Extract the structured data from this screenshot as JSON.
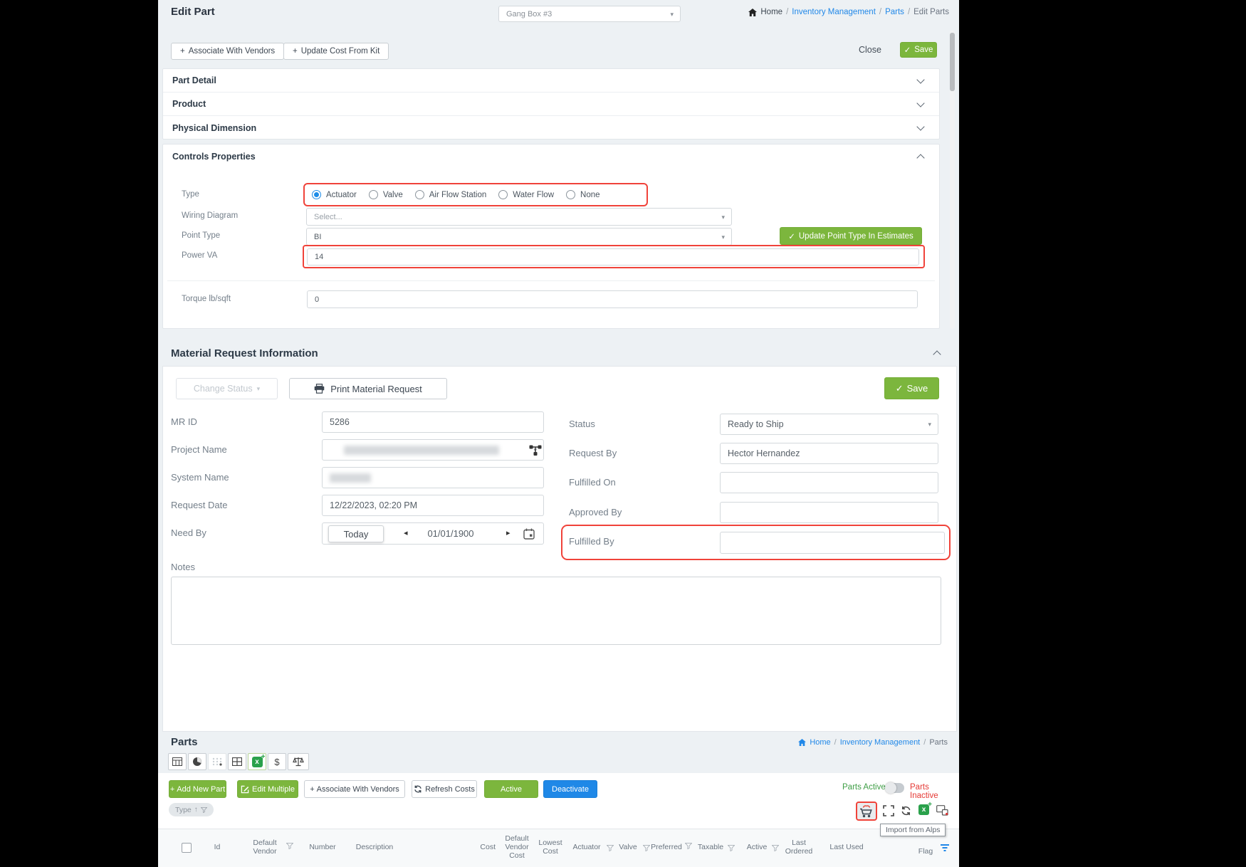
{
  "icons": {
    "plus": "+",
    "check": "✓",
    "caret_down": "▾",
    "caret_left": "◂",
    "caret_right": "▸",
    "sort_up": "↑",
    "dollar": "$",
    "slash": "/"
  },
  "edit_part": {
    "title": "Edit Part",
    "part_selector_value": "Gang Box #3",
    "breadcrumb": {
      "home": "Home",
      "inventory": "Inventory Management",
      "parts": "Parts",
      "current": "Edit Parts"
    },
    "associate_vendors_btn": "Associate With Vendors",
    "update_cost_btn": "Update Cost From Kit",
    "close_btn": "Close",
    "save_btn": "Save",
    "sections": {
      "part_detail": "Part Detail",
      "product": "Product",
      "physical_dimension": "Physical Dimension",
      "controls_properties": "Controls Properties"
    },
    "controls": {
      "type_label": "Type",
      "type_options": [
        "Actuator",
        "Valve",
        "Air Flow Station",
        "Water Flow",
        "None"
      ],
      "selected_type": "Actuator",
      "wiring_label": "Wiring Diagram",
      "wiring_placeholder": "Select...",
      "point_type_label": "Point Type",
      "point_type_value": "BI",
      "update_point_btn": "Update Point Type In Estimates",
      "power_va_label": "Power VA",
      "power_va_value": "14",
      "torque_label": "Torque lb/sqft",
      "torque_value": "0"
    }
  },
  "material_request": {
    "title": "Material Request Information",
    "change_status_btn": "Change Status",
    "print_btn": "Print Material Request",
    "save_btn": "Save",
    "mr_id_label": "MR ID",
    "mr_id_value": "5286",
    "project_name_label": "Project Name",
    "system_name_label": "System Name",
    "request_date_label": "Request Date",
    "request_date_value": "12/22/2023, 02:20 PM",
    "need_by_label": "Need By",
    "today_btn": "Today",
    "need_by_date": "01/01/1900",
    "status_label": "Status",
    "status_value": "Ready to Ship",
    "request_by_label": "Request By",
    "request_by_value": "Hector Hernandez",
    "fulfilled_on_label": "Fulfilled On",
    "approved_by_label": "Approved By",
    "fulfilled_by_label": "Fulfilled By",
    "notes_label": "Notes"
  },
  "parts_grid": {
    "title": "Parts",
    "breadcrumb": {
      "home": "Home",
      "inventory": "Inventory Management",
      "current": "Parts"
    },
    "add_new_btn": "Add New Part",
    "edit_multiple_btn": "Edit Multiple",
    "associate_vendors_btn": "Associate With Vendors",
    "refresh_costs_btn": "Refresh Costs",
    "active_btn": "Active",
    "deactivate_btn": "Deactivate",
    "toggle_active": "Parts Active",
    "toggle_inactive": "Parts Inactive",
    "sort_chip": "Type",
    "tooltip": "Import from Alps",
    "headers": [
      "Id",
      "Default Vendor",
      "Number",
      "Description",
      "Cost",
      "Default Vendor Cost",
      "Lowest Cost",
      "Actuator",
      "Valve",
      "Preferred",
      "Taxable",
      "Active",
      "Last Ordered",
      "Last Used",
      "Flag"
    ]
  },
  "colors": {
    "green": "#7cb63d",
    "blue": "#1f88e7",
    "link": "#2188e8",
    "highlight_red": "#f0433a",
    "active_green": "#3f9e46",
    "inactive_red": "#e53935"
  }
}
